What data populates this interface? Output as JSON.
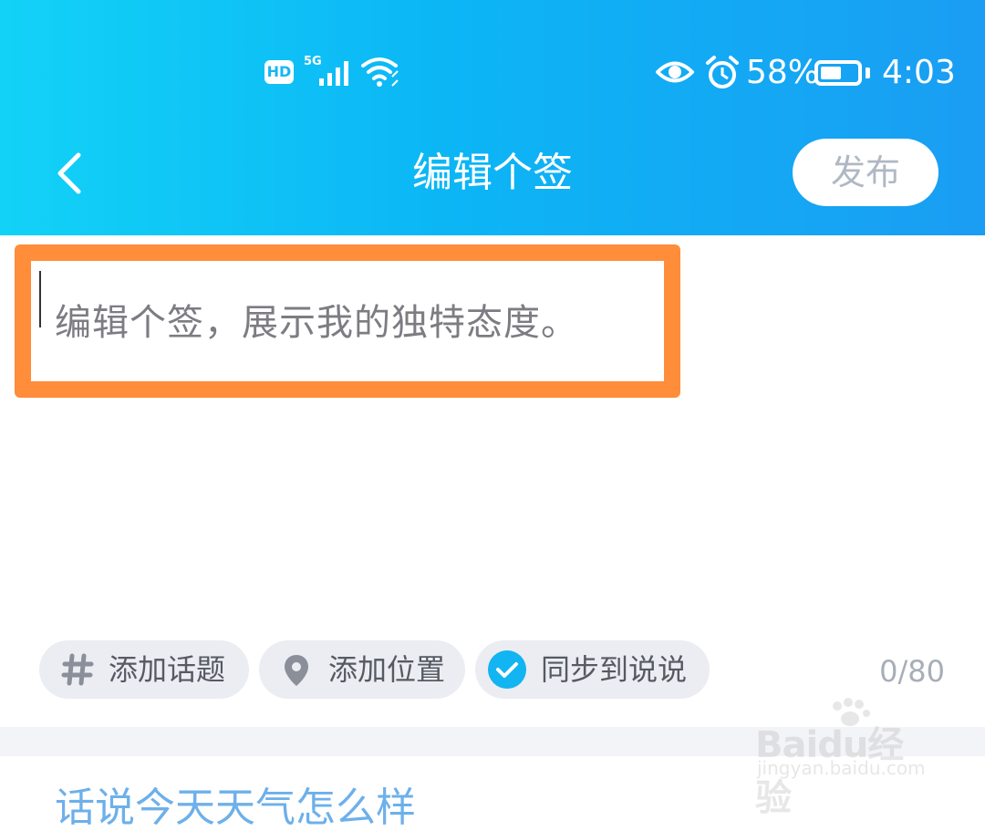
{
  "status_bar": {
    "hd": "HD",
    "network": "5G",
    "battery_percent": "58%",
    "battery_level": 0.58,
    "time": "4:03"
  },
  "nav": {
    "title": "编辑个签",
    "publish_label": "发布"
  },
  "editor": {
    "placeholder": "编辑个签，展示我的独特态度。",
    "highlight_color": "#ff8d3a"
  },
  "chips": [
    {
      "label": "添加话题",
      "icon": "hash-icon"
    },
    {
      "label": "添加位置",
      "icon": "location-pin-icon"
    },
    {
      "label": "同步到说说",
      "icon": "check-circle-icon"
    }
  ],
  "counter": "0/80",
  "below": {
    "partial_text": "话说今天天气怎么样"
  },
  "watermark": {
    "main": "Baidu经验",
    "sub": "jingyan.baidu.com"
  },
  "colors": {
    "header_gradient_start": "#12d2f7",
    "header_gradient_end": "#1a9df3",
    "accent": "#12b4f2"
  }
}
